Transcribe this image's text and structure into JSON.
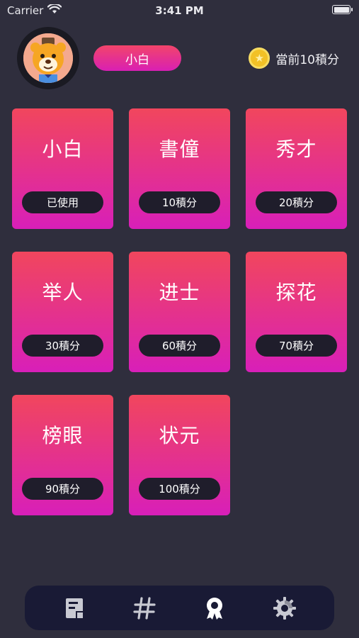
{
  "status_bar": {
    "carrier": "Carrier",
    "time": "3:41 PM"
  },
  "header": {
    "level_name": "小白",
    "points_text": "當前10積分",
    "coin_symbol": "★"
  },
  "cards": [
    {
      "title": "小白",
      "cost": "已使用"
    },
    {
      "title": "書僮",
      "cost": "10積分"
    },
    {
      "title": "秀才",
      "cost": "20積分"
    },
    {
      "title": "举人",
      "cost": "30積分"
    },
    {
      "title": "进士",
      "cost": "60積分"
    },
    {
      "title": "探花",
      "cost": "70積分"
    },
    {
      "title": "榜眼",
      "cost": "90積分"
    },
    {
      "title": "状元",
      "cost": "100積分"
    }
  ],
  "tab_bar": {
    "tabs": [
      {
        "icon": "document-icon"
      },
      {
        "icon": "hashtag-icon"
      },
      {
        "icon": "medal-icon"
      },
      {
        "icon": "gear-icon"
      }
    ]
  },
  "colors": {
    "background": "#2f2e3d",
    "card_top": "#f1465d",
    "card_bottom": "#d81fb9",
    "tab_bar": "#191a35",
    "coin": "#f2c126"
  }
}
